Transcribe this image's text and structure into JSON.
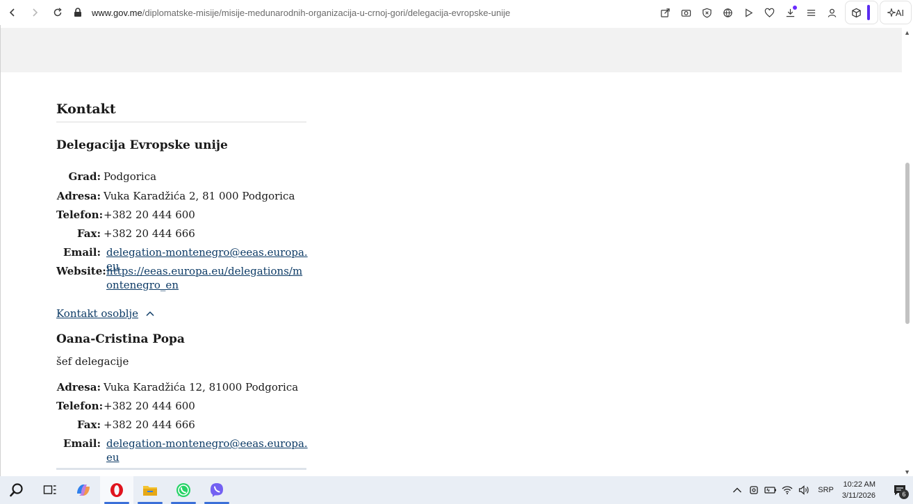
{
  "browser": {
    "url_host": "www.gov.me",
    "url_path": "/diplomatske-misije/misije-medunarodnih-organizacija-u-crnoj-gori/delegacija-evropske-unije",
    "ai_label": "AI"
  },
  "page": {
    "section_title": "Kontakt",
    "org": {
      "name": "Delegacija Evropske unije",
      "rows": [
        {
          "label": "Grad:",
          "value": "Podgorica"
        },
        {
          "label": "Adresa:",
          "value": "Vuka Karadžića 2, 81 000 Podgorica"
        },
        {
          "label": "Telefon:",
          "value": "+382 20 444 600"
        },
        {
          "label": "Fax:",
          "value": "+382 20 444 666"
        },
        {
          "label": "Email:",
          "value": "delegation-montenegro@eeas.europa.eu"
        },
        {
          "label": "Website:",
          "value": "https://eeas.europa.eu/delegations/montenegro_en"
        }
      ]
    },
    "staff_toggle": "Kontakt osoblje",
    "person": {
      "name": "Oana-Cristina Popa",
      "role": "šef delegacije",
      "rows": [
        {
          "label": "Adresa:",
          "value": "Vuka Karadžića 12, 81000 Podgorica"
        },
        {
          "label": "Telefon:",
          "value": "+382 20 444 600"
        },
        {
          "label": "Fax:",
          "value": "+382 20 444 666"
        },
        {
          "label": "Email:",
          "value": "delegation-montenegro@eeas.europa.eu"
        }
      ]
    }
  },
  "taskbar": {
    "lang": "SRP",
    "time": "10:22 AM",
    "date": "3/11/2026",
    "notifications": "6"
  },
  "colors": {
    "link": "#0d3b66",
    "accent": "#5b2cf0"
  }
}
